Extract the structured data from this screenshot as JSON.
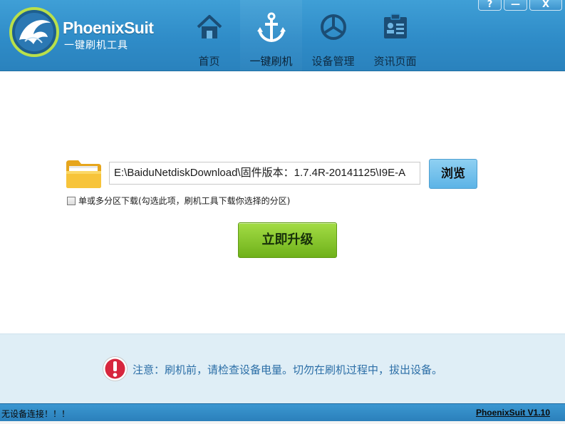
{
  "app": {
    "logo_title": "PhoenixSuit",
    "logo_subtitle": "一键刷机工具"
  },
  "window_controls": {
    "help_label": "?",
    "minimize_label": "—",
    "close_label": "X"
  },
  "nav": {
    "items": [
      {
        "label": "首页",
        "icon": "home-icon"
      },
      {
        "label": "一键刷机",
        "icon": "anchor-icon"
      },
      {
        "label": "设备管理",
        "icon": "device-manage-icon"
      },
      {
        "label": "资讯页面",
        "icon": "news-icon"
      }
    ],
    "active_index": 1
  },
  "flash": {
    "path_value": "E:\\BaiduNetdiskDownload\\固件版本：1.7.4R-20141125\\I9E-A",
    "browse_label": "浏览",
    "partition_checkbox_label": "单或多分区下载(勾选此项，刷机工具下载你选择的分区)",
    "partition_checked": false,
    "upgrade_label": "立即升级"
  },
  "notice": {
    "text": "注意：刷机前，请检查设备电量。切勿在刷机过程中，拔出设备。"
  },
  "status": {
    "left_text": "无设备连接！！！",
    "version_link": "PhoenixSuit V1.10"
  },
  "colors": {
    "header_blue": "#2f8cc8",
    "browse_button": "#5cb3e6",
    "upgrade_button_green": "#7ec127",
    "notice_text": "#2c6fa7",
    "notice_bg": "#dfeef6",
    "warning_red": "#d7263d"
  }
}
